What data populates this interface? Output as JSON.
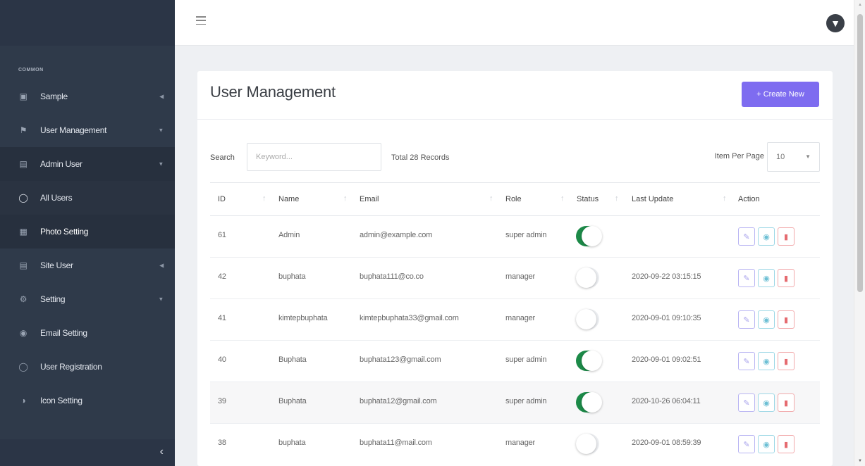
{
  "sidebar": {
    "section": "COMMON",
    "items": [
      {
        "label": "Sample",
        "icon": "box-icon"
      },
      {
        "label": "User Management",
        "icon": "users-icon"
      },
      {
        "label": "Admin User",
        "icon": "file-icon"
      },
      {
        "label": "All Users",
        "icon": "user-icon"
      },
      {
        "label": "Photo Setting",
        "icon": "photo-icon"
      },
      {
        "label": "Site User",
        "icon": "file-icon"
      },
      {
        "label": "Setting",
        "icon": "gear-icon"
      },
      {
        "label": "Email Setting",
        "icon": "at-icon"
      },
      {
        "label": "User Registration",
        "icon": "user-icon"
      },
      {
        "label": "Icon Setting",
        "icon": "contrast-icon"
      }
    ]
  },
  "page": {
    "title": "User Management",
    "create_label": "+ Create New",
    "search_label": "Search",
    "search_placeholder": "Keyword...",
    "total": "Total 28 Records",
    "ipp_label": "Item Per Page",
    "ipp_value": "10"
  },
  "table": {
    "columns": [
      "ID",
      "Name",
      "Email",
      "Role",
      "Status",
      "Last Update",
      "Action"
    ],
    "rows": [
      {
        "id": "61",
        "name": "Admin",
        "email": "admin@example.com",
        "role": "super admin",
        "status": true,
        "updated": ""
      },
      {
        "id": "42",
        "name": "buphata",
        "email": "buphata111@co.co",
        "role": "manager",
        "status": false,
        "updated": "2020-09-22 03:15:15"
      },
      {
        "id": "41",
        "name": "kimtepbuphata",
        "email": "kimtepbuphata33@gmail.com",
        "role": "manager",
        "status": false,
        "updated": "2020-09-01 09:10:35"
      },
      {
        "id": "40",
        "name": "Buphata",
        "email": "buphata123@gmail.com",
        "role": "super admin",
        "status": true,
        "updated": "2020-09-01 09:02:51"
      },
      {
        "id": "39",
        "name": "Buphata",
        "email": "buphata12@gmail.com",
        "role": "super admin",
        "status": true,
        "updated": "2020-10-26 06:04:11"
      },
      {
        "id": "38",
        "name": "buphata",
        "email": "buphata11@mail.com",
        "role": "manager",
        "status": false,
        "updated": "2020-09-01 08:59:39"
      }
    ]
  },
  "colors": {
    "sidebar_bg": "#2f3a4a",
    "accent": "#7e6cf0",
    "toggle_on": "#1c8a48",
    "edit": "#a9a3ec",
    "view": "#6cbfd4",
    "delete": "#e56b70"
  }
}
